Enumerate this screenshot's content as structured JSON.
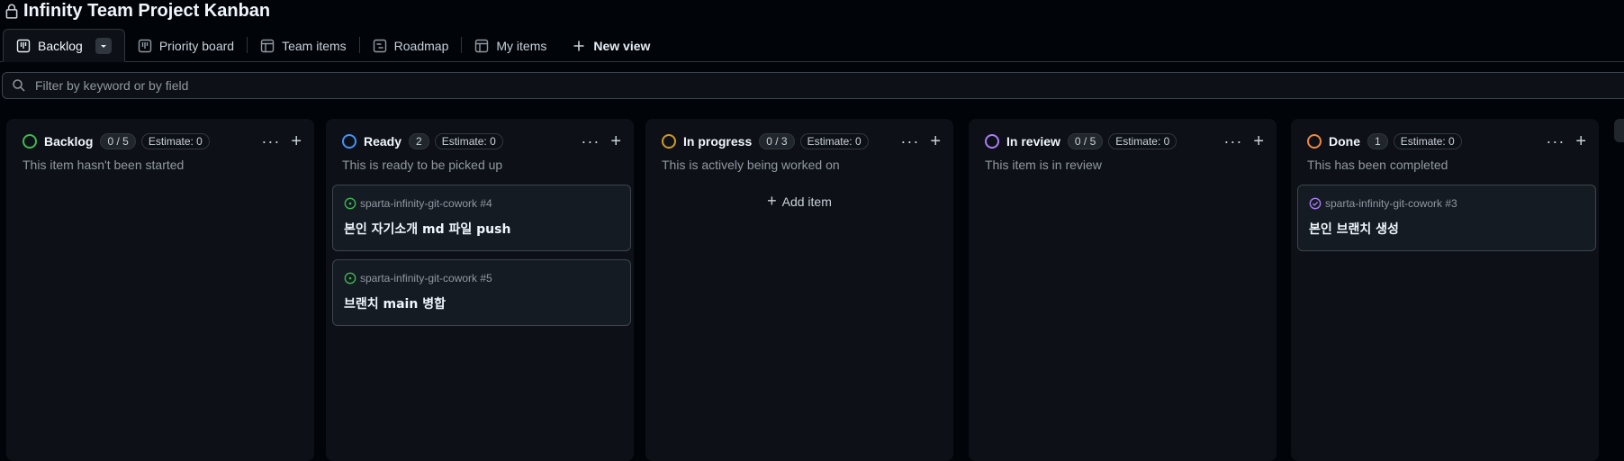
{
  "header": {
    "title": "Infinity Team Project Kanban"
  },
  "tabs": [
    {
      "label": "Backlog"
    },
    {
      "label": "Priority board"
    },
    {
      "label": "Team items"
    },
    {
      "label": "Roadmap"
    },
    {
      "label": "My items"
    },
    {
      "label": "New view"
    }
  ],
  "filter": {
    "placeholder": "Filter by keyword or by field"
  },
  "colors": {
    "backlog": "#3fb950",
    "ready": "#4493f8",
    "in_progress": "#d29922",
    "in_review": "#ab7df8",
    "done": "#f0883e"
  },
  "columns": [
    {
      "name": "Backlog",
      "count": "0 / 5",
      "estimate": "Estimate: 0",
      "description": "This item hasn't been started"
    },
    {
      "name": "Ready",
      "count": "2",
      "estimate": "Estimate: 0",
      "description": "This is ready to be picked up"
    },
    {
      "name": "In progress",
      "count": "0 / 3",
      "estimate": "Estimate: 0",
      "description": "This is actively being worked on",
      "add_item": "Add item"
    },
    {
      "name": "In review",
      "count": "0 / 5",
      "estimate": "Estimate: 0",
      "description": "This item is in review"
    },
    {
      "name": "Done",
      "count": "1",
      "estimate": "Estimate: 0",
      "description": "This has been completed"
    }
  ],
  "cards": {
    "ready": [
      {
        "ref": "sparta-infinity-git-cowork #4",
        "title": "본인 자기소개 md 파일 push"
      },
      {
        "ref": "sparta-infinity-git-cowork #5",
        "title": "브랜치 main 병합"
      }
    ],
    "done": [
      {
        "ref": "sparta-infinity-git-cowork #3",
        "title": "본인 브랜치 생성"
      }
    ]
  }
}
